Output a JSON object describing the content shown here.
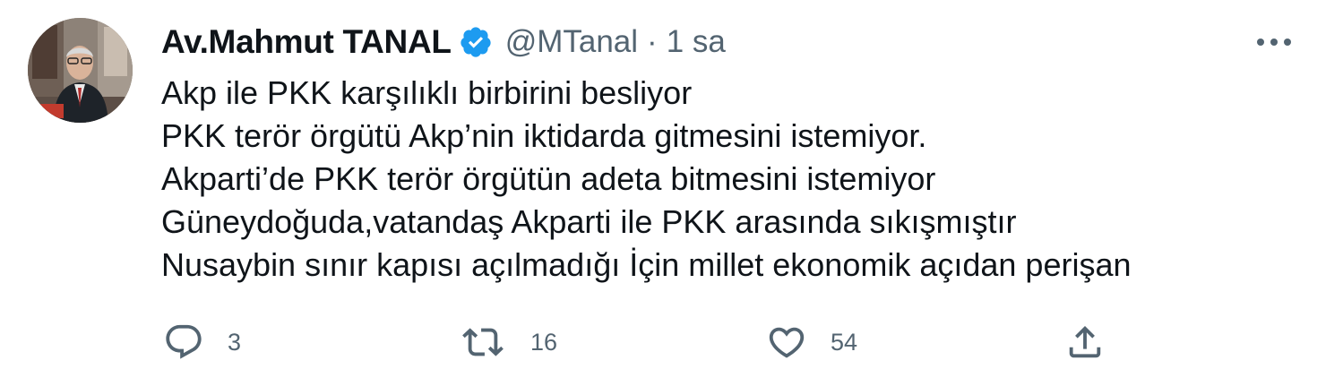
{
  "tweet": {
    "author": {
      "display_name": "Av.Mahmut TANAL",
      "handle": "@MTanal",
      "verified": true
    },
    "separator": "·",
    "time": "1 sa",
    "lines": [
      "Akp ile PKK karşılıklı birbirini besliyor",
      "PKK terör örgütü Akp’nin iktidarda gitmesini istemiyor.",
      "Akparti’de PKK terör örgütün adeta bitmesini istemiyor",
      "Güneydoğuda,vatandaş Akparti ile PKK arasında sıkışmıştır",
      "Nusaybin sınır kapısı açılmadığı İçin millet ekonomik açıdan perişan"
    ],
    "actions": {
      "reply_count": "3",
      "retweet_count": "16",
      "like_count": "54"
    },
    "icons": {
      "reply": "reply-icon",
      "retweet": "retweet-icon",
      "like": "heart-icon",
      "share": "share-icon",
      "more": "more-icon",
      "verified": "verified-badge-icon"
    },
    "colors": {
      "text": "#0f1419",
      "secondary": "#536471",
      "verified": "#1d9bf0"
    }
  }
}
